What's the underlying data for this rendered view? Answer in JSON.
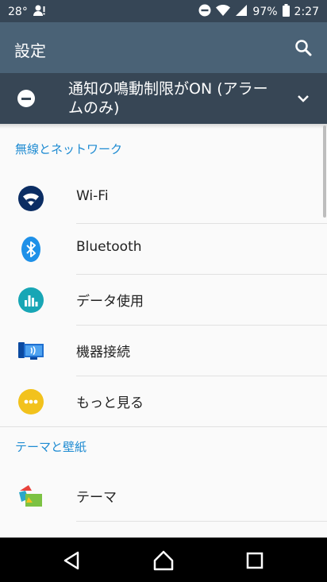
{
  "status_bar": {
    "temperature": "28°",
    "battery": "97%",
    "time": "2:27"
  },
  "app_bar": {
    "title": "設定"
  },
  "dnd_banner": {
    "text": "通知の鳴動制限がON (アラームのみ)"
  },
  "sections": {
    "wireless": {
      "header": "無線とネットワーク",
      "items": [
        {
          "label": "Wi-Fi",
          "icon": "wifi-icon"
        },
        {
          "label": "Bluetooth",
          "icon": "bluetooth-icon"
        },
        {
          "label": "データ使用",
          "icon": "data-usage-icon"
        },
        {
          "label": "機器接続",
          "icon": "device-connection-icon"
        },
        {
          "label": "もっと見る",
          "icon": "more-icon"
        }
      ]
    },
    "themes": {
      "header": "テーマと壁紙",
      "items": [
        {
          "label": "テーマ",
          "icon": "theme-icon"
        }
      ]
    }
  },
  "colors": {
    "status_bar": "#364656",
    "app_bar": "#4a6276",
    "banner": "#374655",
    "accent": "#1e8bd2"
  }
}
